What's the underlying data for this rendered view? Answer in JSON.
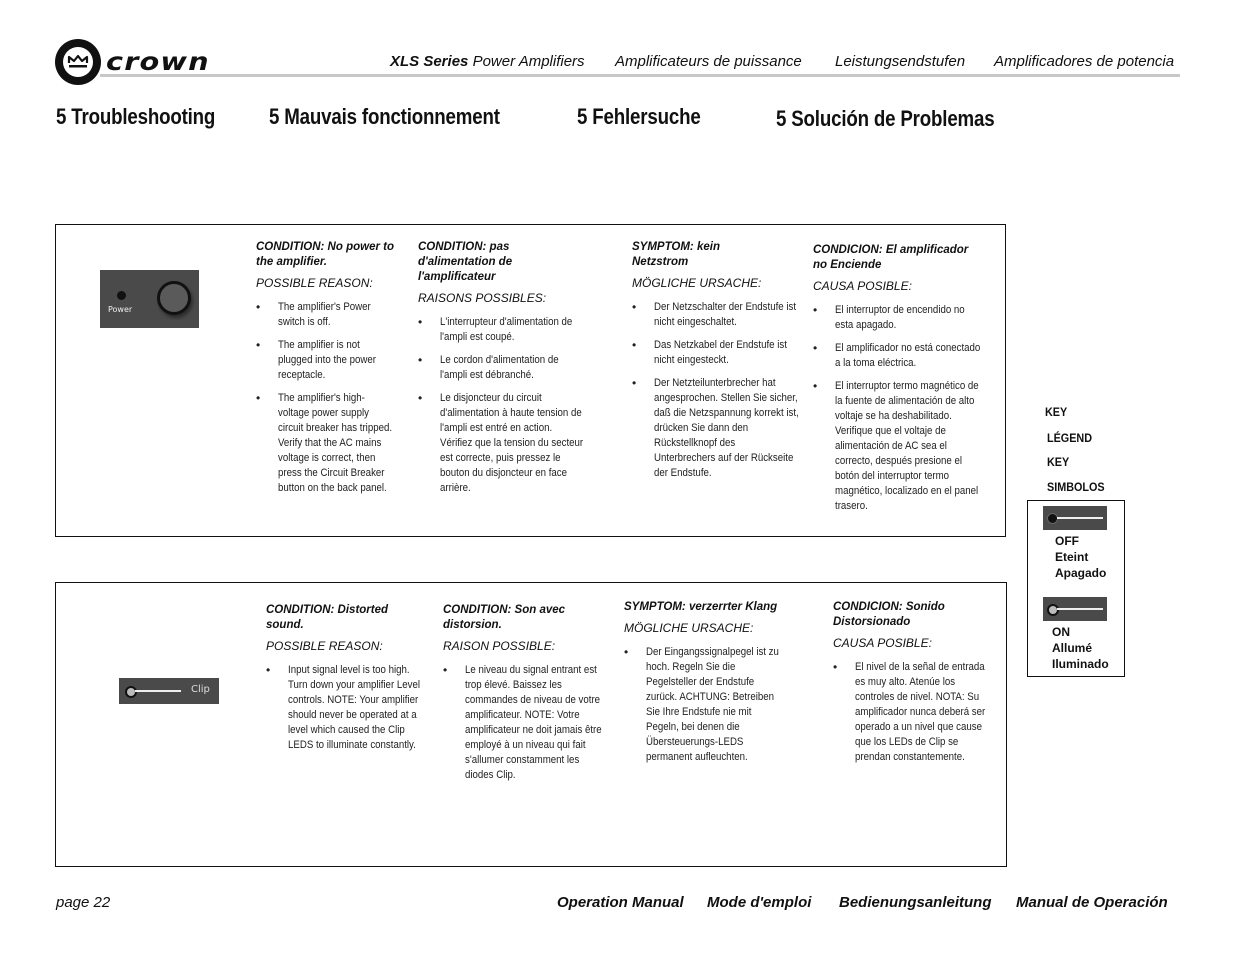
{
  "header": {
    "brand": "crown",
    "series_bold": "XLS Series",
    "series_rest": "Power Amplifiers",
    "languages": [
      "Amplificateurs de puissance",
      "Leistungsendstufen",
      "Amplificadores de potencia"
    ]
  },
  "section_titles": [
    "5 Troubleshooting",
    "5 Mauvais fonctionnement",
    "5 Fehlersuche",
    "5 Solución de Problemas"
  ],
  "box1": {
    "image_label": "Power",
    "columns": [
      {
        "condition": "CONDITION: No power to the amplifier.",
        "reason_header": "POSSIBLE REASON:",
        "items": [
          "The amplifier's Power switch is off.",
          "The amplifier is not plugged into the power receptacle.",
          "The amplifier's high-voltage power supply circuit breaker has tripped. Verify that the AC mains voltage is correct, then press the Circuit Breaker button on the back panel."
        ]
      },
      {
        "condition": "CONDITION: pas d'alimentation de l'amplificateur",
        "reason_header": "RAISONS POSSIBLES:",
        "items": [
          "L'interrupteur d'alimentation de l'ampli est coupé.",
          "Le cordon d'alimentation de l'ampli est débranché.",
          "Le disjoncteur du circuit d'alimentation à haute tension de l'ampli est entré en action. Vérifiez que la tension du secteur est correcte, puis pressez le bouton du disjoncteur en face arrière."
        ]
      },
      {
        "condition": "SYMPTOM: kein Netzstrom",
        "reason_header": "MÖGLICHE URSACHE:",
        "items": [
          "Der Netzschalter der Endstufe ist nicht eingeschaltet.",
          "Das Netzkabel der Endstufe ist nicht eingesteckt.",
          "Der Netzteilunterbrecher hat angesprochen. Stellen Sie sicher, daß die Netzspannung korrekt ist, drücken Sie dann den Rückstellknopf des Unterbrechers auf der Rückseite der Endstufe."
        ]
      },
      {
        "condition": "CONDICION: El amplificador no Enciende",
        "reason_header": "CAUSA POSIBLE:",
        "items": [
          "El interruptor de encendido no esta apagado.",
          "El amplificador no está conectado a la toma eléctrica.",
          "El interruptor termo magnético de la fuente  de alimentación de alto voltaje se ha deshabilitado. Verifique que el voltaje de alimentación  de AC sea el correcto, después presione el botón del interruptor termo magnético, localizado en el panel trasero."
        ]
      }
    ]
  },
  "box2": {
    "image_label": "Clip",
    "columns": [
      {
        "condition": "CONDITION: Distorted sound.",
        "reason_header": "POSSIBLE REASON:",
        "items": [
          "Input signal level is too high. Turn down your amplifier Level controls. NOTE: Your amplifier should never be operated at a level which caused the Clip LEDS to illuminate constantly."
        ]
      },
      {
        "condition": "CONDITION: Son avec distorsion.",
        "reason_header": "RAISON POSSIBLE:",
        "items": [
          "Le niveau du signal entrant est trop élevé. Baissez les commandes de niveau de votre amplificateur. NOTE: Votre amplificateur ne doit jamais être employé à un niveau qui fait s'allumer constamment les diodes Clip."
        ]
      },
      {
        "condition": "SYMPTOM: verzerrter Klang",
        "reason_header": "MÖGLICHE URSACHE:",
        "items": [
          "Der Eingangssignalpegel ist zu hoch. Regeln Sie die Pegelsteller der Endstufe zurück. ACHTUNG: Betreiben Sie Ihre Endstufe nie mit Pegeln, bei denen die Übersteuerungs-LEDS permanent aufleuchten."
        ]
      },
      {
        "condition": "CONDICION: Sonido Distorsionado",
        "reason_header": "CAUSA POSIBLE:",
        "items": [
          "El nivel de la señal de entrada es muy alto. Atenúe los controles de nivel. NOTA: Su amplificador nunca deberá ser operado a un nivel que cause que los LEDs de Clip se prendan constantemente."
        ]
      }
    ]
  },
  "legend": {
    "headings": [
      "KEY",
      "LÉGEND",
      "KEY",
      "SIMBOLOS"
    ],
    "off": [
      "OFF",
      "Eteint",
      "Apagado"
    ],
    "on": [
      "ON",
      "Allumé",
      "Iluminado"
    ]
  },
  "footer": {
    "page": "page 22",
    "manuals": [
      "Operation Manual",
      "Mode d'emploi",
      "Bedienungsanleitung",
      "Manual de Operación"
    ]
  }
}
